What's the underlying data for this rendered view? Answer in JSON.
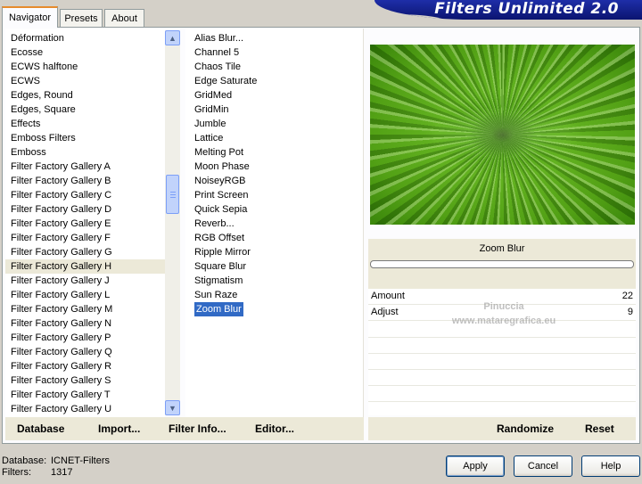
{
  "banner": {
    "title": "Filters Unlimited 2.0"
  },
  "tabs": [
    {
      "label": "Navigator",
      "active": true
    },
    {
      "label": "Presets",
      "active": false
    },
    {
      "label": "About",
      "active": false
    }
  ],
  "categories": {
    "selected": "Filter Factory Gallery H",
    "items": [
      "Déformation",
      "Ecosse",
      "ECWS halftone",
      "ECWS",
      "Edges, Round",
      "Edges, Square",
      "Effects",
      "Emboss Filters",
      "Emboss",
      "Filter Factory Gallery A",
      "Filter Factory Gallery B",
      "Filter Factory Gallery C",
      "Filter Factory Gallery D",
      "Filter Factory Gallery E",
      "Filter Factory Gallery F",
      "Filter Factory Gallery G",
      "Filter Factory Gallery H",
      "Filter Factory Gallery J",
      "Filter Factory Gallery L",
      "Filter Factory Gallery M",
      "Filter Factory Gallery N",
      "Filter Factory Gallery P",
      "Filter Factory Gallery Q",
      "Filter Factory Gallery R",
      "Filter Factory Gallery S",
      "Filter Factory Gallery T",
      "Filter Factory Gallery U"
    ]
  },
  "filters": {
    "selected": "Zoom Blur",
    "items": [
      "Alias Blur...",
      "Channel 5",
      "Chaos Tile",
      "Edge Saturate",
      "GridMed",
      "GridMin",
      "Jumble",
      "Lattice",
      "Melting Pot",
      "Moon Phase",
      "NoiseyRGB",
      "Print Screen",
      "Quick Sepia",
      "Reverb...",
      "RGB Offset",
      "Ripple Mirror",
      "Square Blur",
      "Stigmatism",
      "Sun Raze",
      "Zoom Blur"
    ]
  },
  "settings": {
    "filter_name": "Zoom Blur",
    "params": [
      {
        "label": "Amount",
        "value": "22"
      },
      {
        "label": "Adjust",
        "value": "9"
      }
    ]
  },
  "watermark": {
    "line1": "Pinuccia",
    "line2": "www.mataregrafica.eu"
  },
  "links": {
    "database": "Database",
    "import": "Import...",
    "filter_info": "Filter Info...",
    "editor": "Editor...",
    "randomize": "Randomize",
    "reset": "Reset"
  },
  "status": {
    "database_label": "Database:",
    "database_value": "ICNET-Filters",
    "filters_label": "Filters:",
    "filters_value": "1317"
  },
  "buttons": {
    "apply": "Apply",
    "cancel": "Cancel",
    "help": "Help"
  },
  "colors": {
    "accent_selection": "#316ac5",
    "banner": "#1e2ea8",
    "tab_highlight": "#e68b2c"
  }
}
